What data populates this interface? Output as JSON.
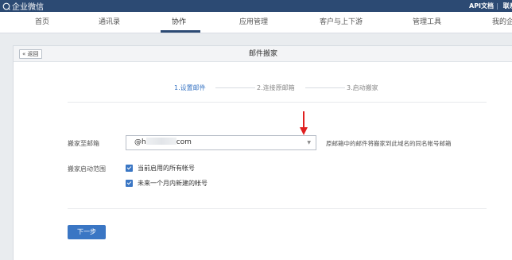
{
  "app": {
    "brand": "企业微信"
  },
  "top_links": {
    "api_doc": "API文档",
    "separator": "|",
    "partial": "联系"
  },
  "nav": {
    "items": [
      {
        "label": "首页"
      },
      {
        "label": "通讯录"
      },
      {
        "label": "协作",
        "active": true
      },
      {
        "label": "应用管理"
      },
      {
        "label": "客户与上下游"
      },
      {
        "label": "管理工具"
      },
      {
        "label": "我的企"
      }
    ]
  },
  "panel": {
    "back_label": "« 返回",
    "title": "邮件搬家"
  },
  "steps": [
    {
      "label": "1.设置邮件",
      "active": true
    },
    {
      "label": "2.连接原邮箱",
      "active": false
    },
    {
      "label": "3.启动搬家",
      "active": false
    }
  ],
  "form": {
    "target_label": "搬家至邮箱",
    "target_value_prefix": "@h",
    "target_value_suffix": "com",
    "target_hint": "原邮箱中的邮件将搬家到此域名的同名帐号邮箱",
    "scope_label": "搬家启动范围",
    "options": [
      {
        "label": "当前启用的所有帐号",
        "checked": true
      },
      {
        "label": "未来一个月内新建的帐号",
        "checked": true
      }
    ],
    "next_label": "下一步"
  },
  "colors": {
    "topbar": "#2c4a73",
    "accent": "#3a76c4",
    "arrow": "#e02020"
  }
}
